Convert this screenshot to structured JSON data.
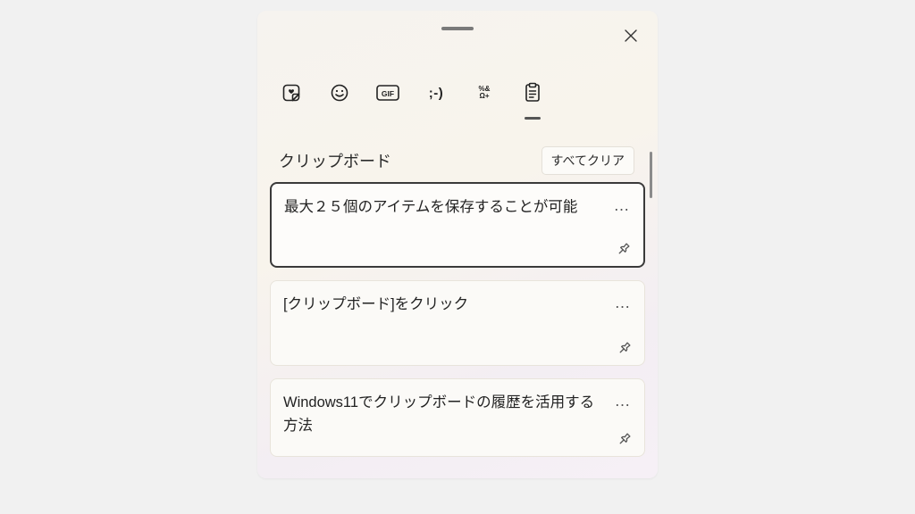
{
  "header": {
    "title": "クリップボード",
    "clear_all_label": "すべてクリア"
  },
  "tabs": {
    "heart": "heart-sticker-icon",
    "emoji": "emoji-icon",
    "gif": "gif-icon",
    "kaomoji": "kaomoji-icon",
    "kaomoji_glyph": ";-)",
    "symbols": "symbols-icon",
    "symbols_glyph": "%&\nΩ+",
    "clipboard": "clipboard-icon",
    "active": "clipboard"
  },
  "items": [
    {
      "text": "最大２５個のアイテムを保存することが可能",
      "selected": true
    },
    {
      "text": "[クリップボード]をクリック",
      "selected": false
    },
    {
      "text": "Windows11でクリップボードの履歴を活用する方法",
      "selected": false
    }
  ],
  "glyphs": {
    "more": "…"
  }
}
